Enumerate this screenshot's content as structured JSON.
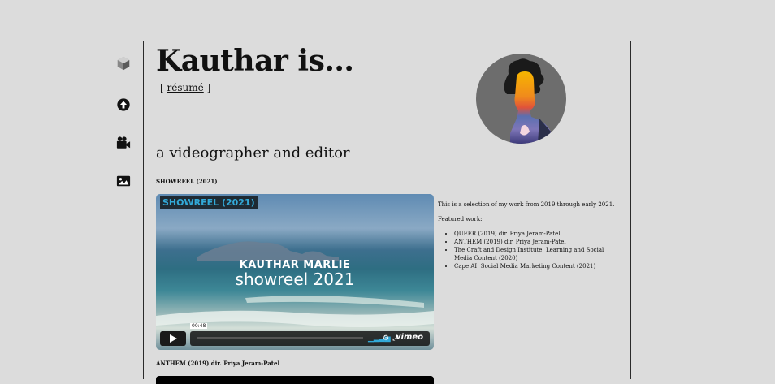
{
  "header": {
    "title": "Kauthar is...",
    "resume_open": "[",
    "resume_label": "résumé",
    "resume_close": "]",
    "subtitle": "a videographer and editor"
  },
  "nav": {
    "icons": [
      "logo-cube-icon",
      "arrow-up-circle-icon",
      "video-camera-icon",
      "image-icon"
    ]
  },
  "showreel": {
    "label": "SHOWREEL (2021)",
    "video": {
      "title": "SHOWREEL (2021)",
      "overlay_line1": "KAUTHAR MARLIE",
      "overlay_line2": "showreel 2021",
      "time": "00:48",
      "brand": "vimeo",
      "progress": 0
    },
    "description": "This is a selection of my work from 2019 through early 2021.",
    "featured_label": "Featured work:",
    "featured": [
      "QUEER (2019) dir. Priya Jeram-Patel",
      "ANTHEM (2019) dir. Priya Jeram-Patel",
      "The Craft and Design Institute: Learning and Social Media Content (2020)",
      "Cape AI: Social Media Marketing Content (2021)"
    ]
  },
  "next_section": {
    "label": "ANTHEM (2019) dir. Priya Jeram-Patel"
  }
}
